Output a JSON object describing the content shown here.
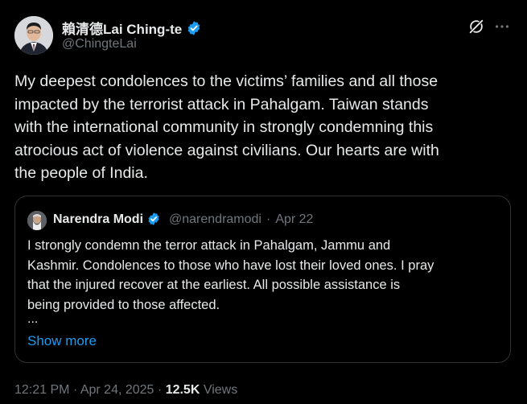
{
  "author": {
    "display_name": "賴清德Lai Ching-te",
    "handle": "@ChingteLai",
    "verified_icon": "verified-badge-icon"
  },
  "tweet": {
    "text": "My deepest condolences to the victims’ families and all those\nimpacted by the terrorist attack in Pahalgam. Taiwan stands\nwith the international community in strongly condemning this\natrocious act of violence against civilians. Our hearts are with\nthe people of India."
  },
  "quoted": {
    "display_name": "Narendra Modi",
    "handle": "@narendramodi",
    "separator": "·",
    "date": "Apr 22",
    "text": "I strongly condemn the terror attack in Pahalgam, Jammu and\nKashmir. Condolences to those who have lost their loved ones. I pray\nthat the injured recover at the earliest. All possible assistance is\nbeing provided to those affected.",
    "ellipsis": "...",
    "show_more": "Show more"
  },
  "footer": {
    "time": "12:21 PM",
    "separator": "·",
    "date": "Apr 24, 2025",
    "views_count": "12.5K",
    "views_label": "Views"
  },
  "colors": {
    "background": "#000000",
    "text": "#e7e9ea",
    "secondary": "#71767b",
    "accent": "#1d9bf0",
    "border": "#2f3336"
  },
  "icons": [
    "grok-icon",
    "more-options-icon",
    "verified-badge-icon"
  ]
}
